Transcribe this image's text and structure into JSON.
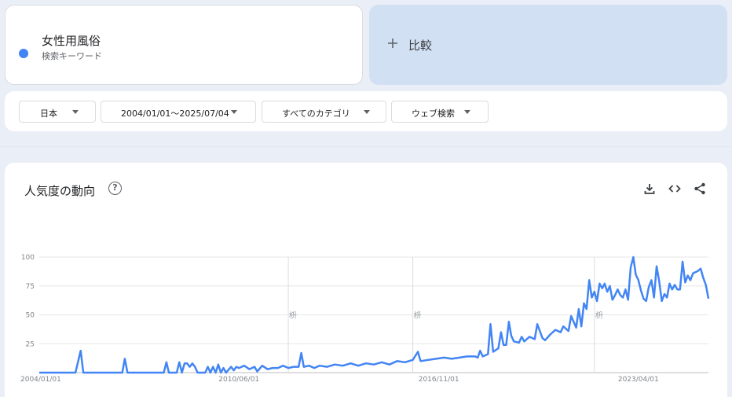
{
  "term": {
    "name": "女性用風俗",
    "type": "検索キーワード",
    "color": "#4285f4"
  },
  "compare": {
    "icon": "plus-icon",
    "label": "比較"
  },
  "filters": {
    "region": "日本",
    "date_range": "2004/01/01〜2025/07/04",
    "category": "すべてのカテゴリ",
    "search_type": "ウェブ検索"
  },
  "chart_section": {
    "title": "人気度の動向",
    "help_icon": "help-circle-icon",
    "download_icon": "download-icon",
    "embed_icon": "code-icon",
    "share_icon": "share-icon"
  },
  "chart_data": {
    "type": "line",
    "series": [
      {
        "color": "#4285f4",
        "points": [
          [
            "2004-01-01",
            0
          ],
          [
            "2004-06-01",
            0
          ],
          [
            "2005-01-01",
            0
          ],
          [
            "2005-03-01",
            0
          ],
          [
            "2005-05-01",
            19
          ],
          [
            "2005-06-01",
            0
          ],
          [
            "2006-01-01",
            0
          ],
          [
            "2006-09-01",
            0
          ],
          [
            "2006-10-01",
            12
          ],
          [
            "2006-11-01",
            0
          ],
          [
            "2007-06-01",
            0
          ],
          [
            "2008-01-01",
            0
          ],
          [
            "2008-02-01",
            9
          ],
          [
            "2008-03-01",
            0
          ],
          [
            "2008-06-01",
            0
          ],
          [
            "2008-07-01",
            9
          ],
          [
            "2008-08-01",
            0
          ],
          [
            "2008-09-01",
            8
          ],
          [
            "2008-10-01",
            8
          ],
          [
            "2008-11-01",
            5
          ],
          [
            "2008-12-01",
            8
          ],
          [
            "2009-01-01",
            5
          ],
          [
            "2009-02-01",
            0
          ],
          [
            "2009-05-01",
            0
          ],
          [
            "2009-06-01",
            5
          ],
          [
            "2009-07-01",
            0
          ],
          [
            "2009-08-01",
            5
          ],
          [
            "2009-09-01",
            0
          ],
          [
            "2009-10-01",
            7
          ],
          [
            "2009-11-01",
            0
          ],
          [
            "2009-12-01",
            4
          ],
          [
            "2010-01-01",
            0
          ],
          [
            "2010-03-01",
            5
          ],
          [
            "2010-04-01",
            2
          ],
          [
            "2010-05-01",
            5
          ],
          [
            "2010-06-01",
            4
          ],
          [
            "2010-08-01",
            6
          ],
          [
            "2010-10-01",
            3
          ],
          [
            "2010-12-01",
            5
          ],
          [
            "2011-01-01",
            1
          ],
          [
            "2011-03-01",
            6
          ],
          [
            "2011-05-01",
            3
          ],
          [
            "2011-07-01",
            4
          ],
          [
            "2011-09-01",
            4
          ],
          [
            "2011-11-01",
            6
          ],
          [
            "2012-01-01",
            4
          ],
          [
            "2012-03-01",
            5
          ],
          [
            "2012-05-01",
            5
          ],
          [
            "2012-06-01",
            17
          ],
          [
            "2012-07-01",
            5
          ],
          [
            "2012-09-01",
            6
          ],
          [
            "2012-11-01",
            4
          ],
          [
            "2013-01-01",
            6
          ],
          [
            "2013-04-01",
            5
          ],
          [
            "2013-07-01",
            7
          ],
          [
            "2013-10-01",
            6
          ],
          [
            "2014-01-01",
            8
          ],
          [
            "2014-04-01",
            6
          ],
          [
            "2014-07-01",
            8
          ],
          [
            "2014-10-01",
            7
          ],
          [
            "2015-01-01",
            9
          ],
          [
            "2015-04-01",
            7
          ],
          [
            "2015-07-01",
            10
          ],
          [
            "2015-10-01",
            9
          ],
          [
            "2016-01-01",
            11
          ],
          [
            "2016-03-01",
            18
          ],
          [
            "2016-04-01",
            10
          ],
          [
            "2016-07-01",
            11
          ],
          [
            "2016-10-01",
            12
          ],
          [
            "2017-01-01",
            13
          ],
          [
            "2017-04-01",
            12
          ],
          [
            "2017-07-01",
            13
          ],
          [
            "2017-10-01",
            14
          ],
          [
            "2018-01-01",
            14
          ],
          [
            "2018-02-01",
            13
          ],
          [
            "2018-03-01",
            19
          ],
          [
            "2018-04-01",
            14
          ],
          [
            "2018-06-01",
            16
          ],
          [
            "2018-07-01",
            42
          ],
          [
            "2018-08-01",
            18
          ],
          [
            "2018-10-01",
            21
          ],
          [
            "2018-11-01",
            35
          ],
          [
            "2018-12-01",
            24
          ],
          [
            "2019-01-01",
            24
          ],
          [
            "2019-02-01",
            44
          ],
          [
            "2019-03-01",
            32
          ],
          [
            "2019-04-01",
            27
          ],
          [
            "2019-06-01",
            26
          ],
          [
            "2019-07-01",
            31
          ],
          [
            "2019-08-01",
            27
          ],
          [
            "2019-10-01",
            31
          ],
          [
            "2019-12-01",
            29
          ],
          [
            "2020-01-01",
            42
          ],
          [
            "2020-03-01",
            30
          ],
          [
            "2020-04-01",
            28
          ],
          [
            "2020-06-01",
            33
          ],
          [
            "2020-08-01",
            37
          ],
          [
            "2020-10-01",
            35
          ],
          [
            "2020-11-01",
            40
          ],
          [
            "2021-01-01",
            36
          ],
          [
            "2021-02-01",
            49
          ],
          [
            "2021-04-01",
            39
          ],
          [
            "2021-05-01",
            55
          ],
          [
            "2021-06-01",
            40
          ],
          [
            "2021-07-01",
            60
          ],
          [
            "2021-08-01",
            55
          ],
          [
            "2021-09-01",
            80
          ],
          [
            "2021-10-01",
            65
          ],
          [
            "2021-11-01",
            70
          ],
          [
            "2021-12-01",
            62
          ],
          [
            "2022-01-01",
            77
          ],
          [
            "2022-02-01",
            73
          ],
          [
            "2022-03-01",
            77
          ],
          [
            "2022-04-01",
            70
          ],
          [
            "2022-05-01",
            75
          ],
          [
            "2022-06-01",
            63
          ],
          [
            "2022-07-01",
            67
          ],
          [
            "2022-08-01",
            72
          ],
          [
            "2022-09-01",
            67
          ],
          [
            "2022-10-01",
            65
          ],
          [
            "2022-11-01",
            72
          ],
          [
            "2022-12-01",
            63
          ],
          [
            "2023-01-01",
            91
          ],
          [
            "2023-02-01",
            100
          ],
          [
            "2023-03-01",
            85
          ],
          [
            "2023-04-01",
            80
          ],
          [
            "2023-05-01",
            71
          ],
          [
            "2023-06-01",
            64
          ],
          [
            "2023-07-01",
            62
          ],
          [
            "2023-08-01",
            74
          ],
          [
            "2023-09-01",
            80
          ],
          [
            "2023-10-01",
            65
          ],
          [
            "2023-11-01",
            92
          ],
          [
            "2023-12-01",
            79
          ],
          [
            "2024-01-01",
            62
          ],
          [
            "2024-02-01",
            68
          ],
          [
            "2024-03-01",
            65
          ],
          [
            "2024-04-01",
            77
          ],
          [
            "2024-05-01",
            72
          ],
          [
            "2024-06-01",
            76
          ],
          [
            "2024-07-01",
            72
          ],
          [
            "2024-08-01",
            72
          ],
          [
            "2024-09-01",
            96
          ],
          [
            "2024-10-01",
            78
          ],
          [
            "2024-11-01",
            84
          ],
          [
            "2024-12-01",
            80
          ],
          [
            "2025-01-01",
            86
          ],
          [
            "2025-03-01",
            88
          ],
          [
            "2025-04-01",
            90
          ],
          [
            "2025-05-01",
            82
          ],
          [
            "2025-06-01",
            76
          ],
          [
            "2025-07-01",
            64
          ]
        ]
      }
    ],
    "x_tick_labels": [
      "2004/01/01",
      "2010/06/01",
      "2016/11/01",
      "2023/04/01"
    ],
    "y_tick_labels": [
      "100",
      "75",
      "50",
      "25"
    ],
    "ylim": [
      0,
      100
    ],
    "annotations": [
      {
        "date": "2012-01-01",
        "text": "枡"
      },
      {
        "date": "2016-01-01",
        "text": "枡"
      },
      {
        "date": "2021-11-01",
        "text": "枡"
      }
    ],
    "grid": true,
    "legend": "none"
  }
}
